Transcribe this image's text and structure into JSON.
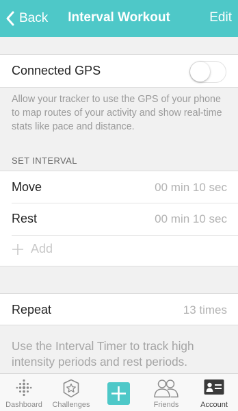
{
  "colors": {
    "accent": "#4ec8c8",
    "background": "#f1f1f1",
    "cell": "#ffffff",
    "secondary_text": "#b3b3b3"
  },
  "nav": {
    "back_label": "Back",
    "title": "Interval Workout",
    "edit_label": "Edit"
  },
  "gps": {
    "label": "Connected GPS",
    "enabled": false,
    "description": "Allow your tracker to use the GPS of your phone to map routes of your activity and show real-time stats like pace and distance."
  },
  "interval": {
    "header": "SET INTERVAL",
    "rows": [
      {
        "label": "Move",
        "value": "00 min 10 sec"
      },
      {
        "label": "Rest",
        "value": "00 min 10 sec"
      }
    ],
    "add_label": "Add"
  },
  "repeat": {
    "label": "Repeat",
    "value": "13 times"
  },
  "info_text": "Use the Interval Timer to track high intensity periods and rest periods.",
  "tabbar": {
    "tabs": [
      {
        "label": "Dashboard",
        "icon": "dots-grid-icon"
      },
      {
        "label": "Challenges",
        "icon": "star-badge-icon"
      },
      {
        "label": "Friends",
        "icon": "people-icon"
      },
      {
        "label": "Account",
        "icon": "id-card-icon",
        "active": true
      }
    ]
  }
}
